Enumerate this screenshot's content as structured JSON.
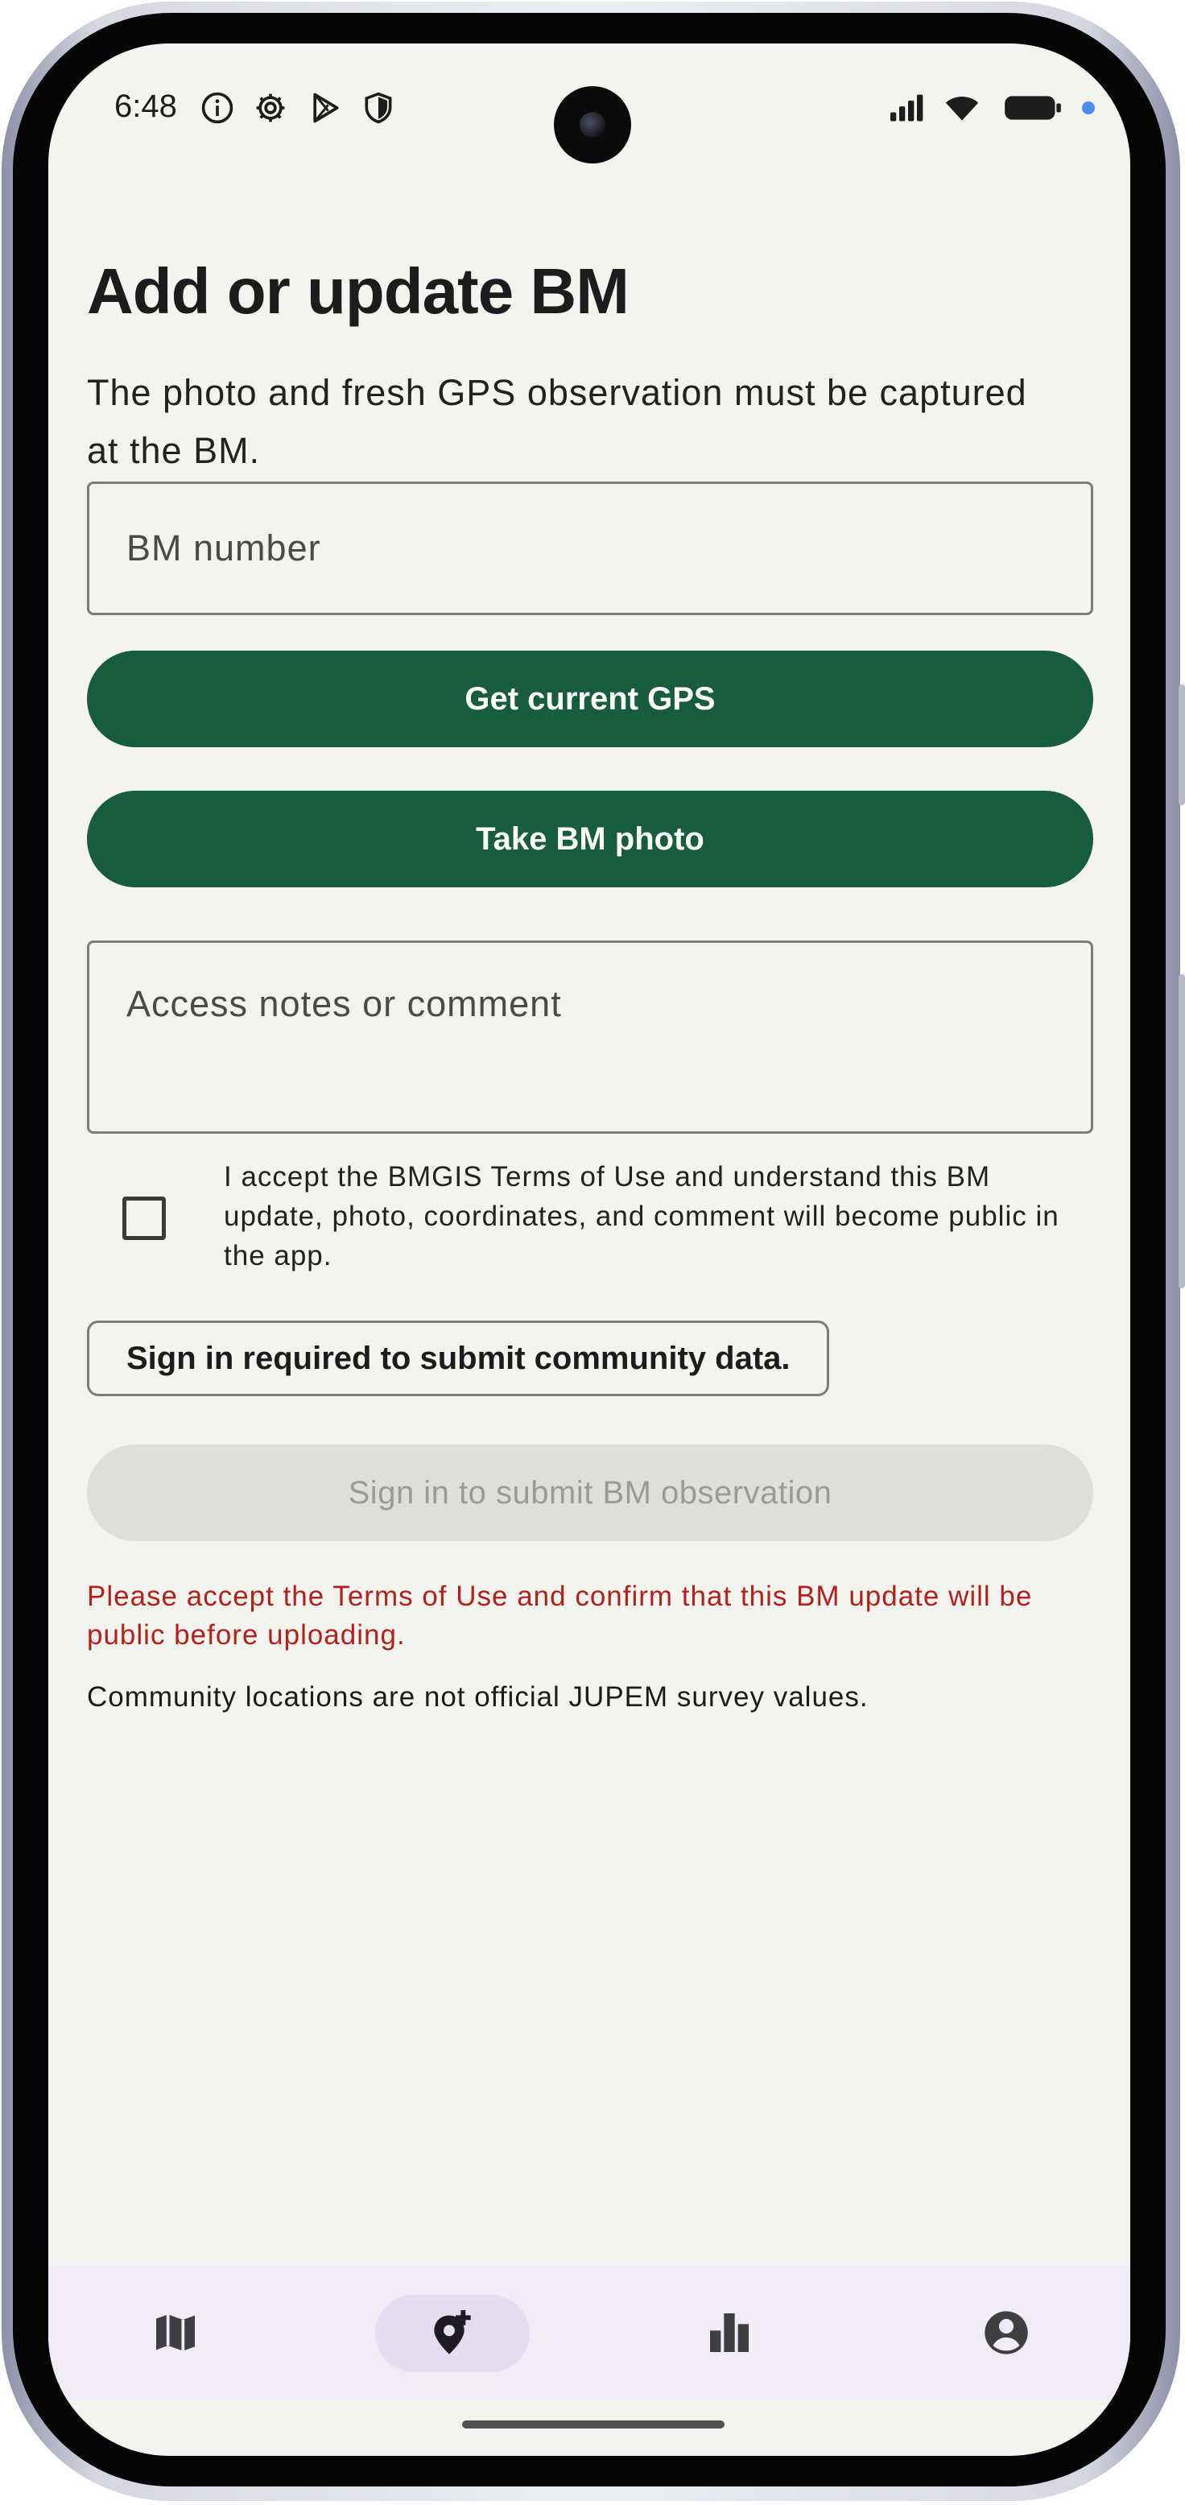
{
  "status_bar": {
    "time": "6:48",
    "left_icons": [
      "info-icon",
      "gear-icon",
      "play-store-icon",
      "shield-icon"
    ],
    "right_icons": [
      "signal-icon",
      "wifi-icon",
      "battery-icon"
    ]
  },
  "page": {
    "title": "Add or update BM",
    "subtitle": "The photo and fresh GPS observation must be captured at the BM."
  },
  "form": {
    "bm_number_placeholder": "BM number",
    "gps_button_label": "Get current GPS",
    "photo_button_label": "Take BM photo",
    "notes_placeholder": "Access notes or comment",
    "terms_label": "I accept the BMGIS Terms of Use and understand this BM update, photo, coordinates, and comment will become public in the app.",
    "terms_checked": false,
    "signin_notice": "Sign in required to submit community data.",
    "submit_label": "Sign in to submit BM observation",
    "submit_enabled": false,
    "error_message": "Please accept the Terms of Use and confirm that this BM update will be public before uploading.",
    "footer_note": "Community locations are not official JUPEM survey values."
  },
  "bottom_nav": {
    "items": [
      "map-icon",
      "add-location-icon",
      "bar-chart-icon",
      "account-icon"
    ],
    "active_index": 1
  },
  "colors": {
    "primary": "#175c3c",
    "error": "#b3211d",
    "background": "#f4f4ef",
    "nav_background": "#f1ecf7",
    "nav_active": "#e6ddf3"
  }
}
